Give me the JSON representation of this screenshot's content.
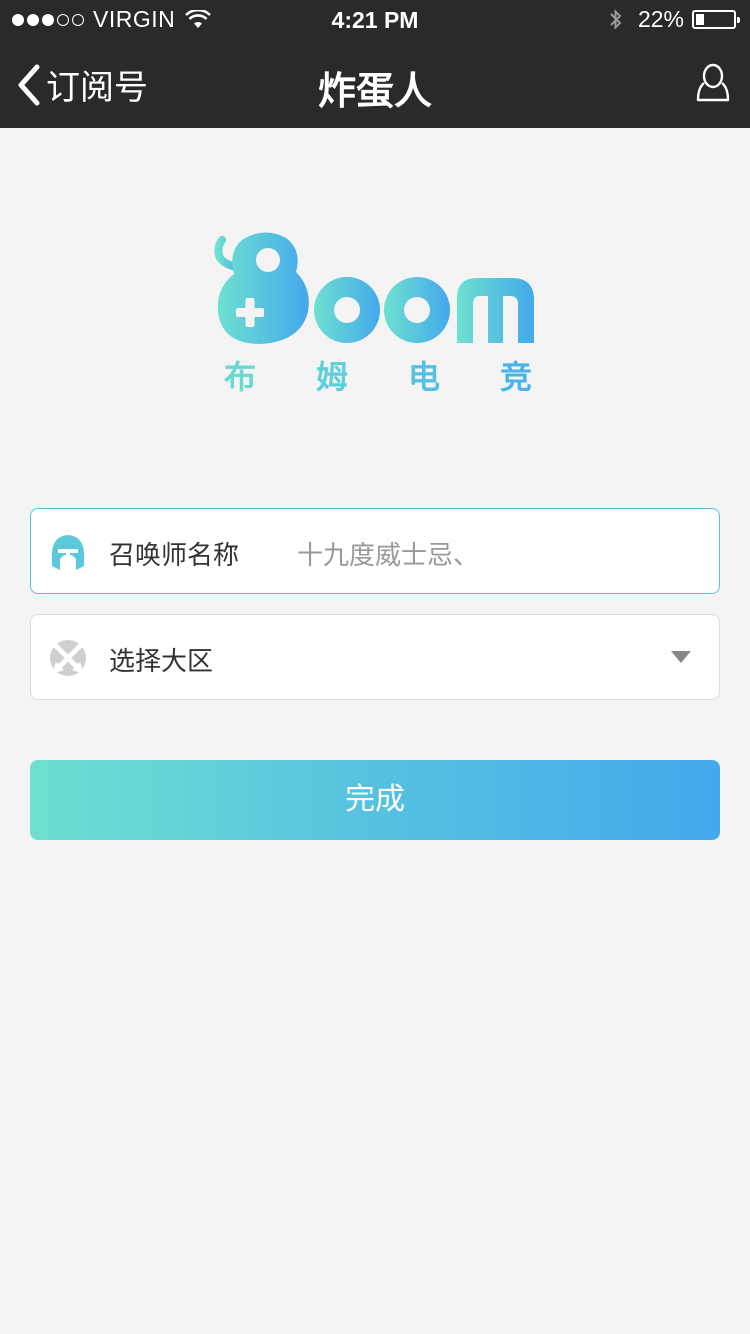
{
  "status_bar": {
    "carrier": "VIRGIN",
    "time": "4:21 PM",
    "battery": "22%",
    "battery_level": 0.22
  },
  "nav": {
    "back_label": "订阅号",
    "title": "炸蛋人"
  },
  "logo": {
    "wordmark": "Boom",
    "subtitle": [
      "布",
      "姆",
      "电",
      "竞"
    ],
    "colors": {
      "start": "#6ee0d0",
      "end": "#44a8ec"
    }
  },
  "form": {
    "summoner": {
      "label": "召唤师名称",
      "value": "十九度威士忌、",
      "icon": "helmet-icon"
    },
    "region": {
      "label": "选择大区",
      "icon": "crossed-swords-icon"
    },
    "submit_label": "完成"
  },
  "colors": {
    "nav_background": "#2a2a2a",
    "page_background": "#f4f4f4",
    "active_border": "#59c4dc"
  }
}
